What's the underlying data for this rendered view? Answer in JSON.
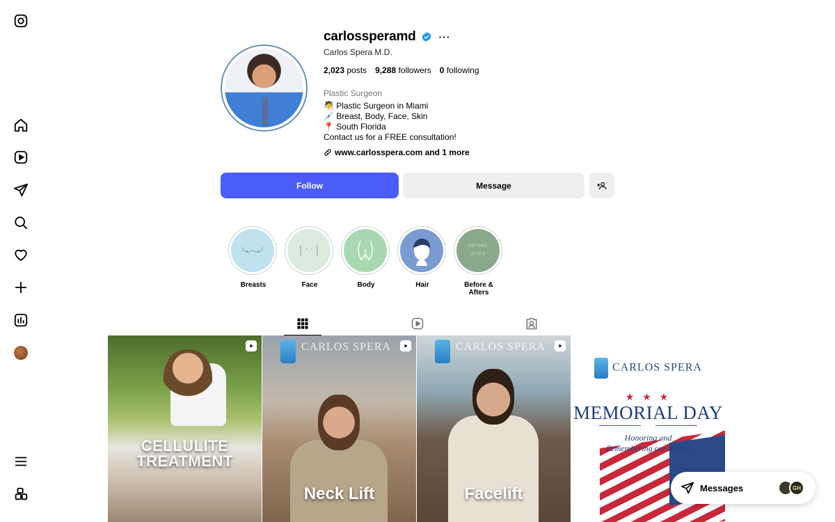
{
  "sidebar": {
    "items": [
      {
        "name": "instagram-logo-icon"
      },
      {
        "name": "home-icon"
      },
      {
        "name": "reels-icon"
      },
      {
        "name": "messages-icon"
      },
      {
        "name": "search-icon"
      },
      {
        "name": "notifications-icon"
      },
      {
        "name": "create-icon"
      },
      {
        "name": "dashboard-icon"
      },
      {
        "name": "profile-avatar"
      },
      {
        "name": "more-menu-icon"
      },
      {
        "name": "also-from-meta-icon"
      }
    ]
  },
  "profile": {
    "username": "carlossperamd",
    "verified": true,
    "full_name": "Carlos Spera M.D.",
    "stats": {
      "posts_count": "2,023",
      "posts_label": "posts",
      "followers_count": "9,288",
      "followers_label": "followers",
      "following_count": "0",
      "following_label": "following"
    },
    "category": "Plastic Surgeon",
    "bio_lines": [
      "🧖 Plastic Surgeon in Miami",
      "💉 Breast, Body, Face, Skin",
      "📍 South Florida",
      "Contact us for a FREE consultation!"
    ],
    "link_text": "www.carlosspera.com and 1 more"
  },
  "actions": {
    "follow_label": "Follow",
    "message_label": "Message"
  },
  "highlights": [
    {
      "label": "Breasts",
      "color": "#bfe3ee"
    },
    {
      "label": "Face",
      "color": "#dcebe0"
    },
    {
      "label": "Body",
      "color": "#a8d8b0"
    },
    {
      "label": "Hair",
      "color": "#7a9ad2"
    },
    {
      "label": "Before & Afters",
      "color": "#8aa88c",
      "inner_text": "BEFORE AFTER"
    }
  ],
  "tabs": [
    {
      "name": "posts",
      "active": true
    },
    {
      "name": "reels",
      "active": false
    },
    {
      "name": "tagged",
      "active": false
    }
  ],
  "posts": [
    {
      "caption": "CELLULITE TREATMENT",
      "reel": true
    },
    {
      "caption": "Neck Lift",
      "brand": "CARLOS SPERA",
      "reel": true
    },
    {
      "caption": "Facelift",
      "brand": "CARLOS SPERA",
      "reel": true
    },
    {
      "brand": "CARLOS SPERA",
      "title": "MEMORIAL DAY",
      "subtitle_1": "Honoring and",
      "subtitle_2": "Remembering our heroes",
      "stars": "★ ★ ★",
      "reel": false
    }
  ],
  "messages_pill": {
    "label": "Messages",
    "avatar_initials": "GH"
  },
  "colors": {
    "follow_button": "#4a5df9",
    "secondary_button": "#efefef",
    "verified_badge": "#1d9bf0"
  }
}
